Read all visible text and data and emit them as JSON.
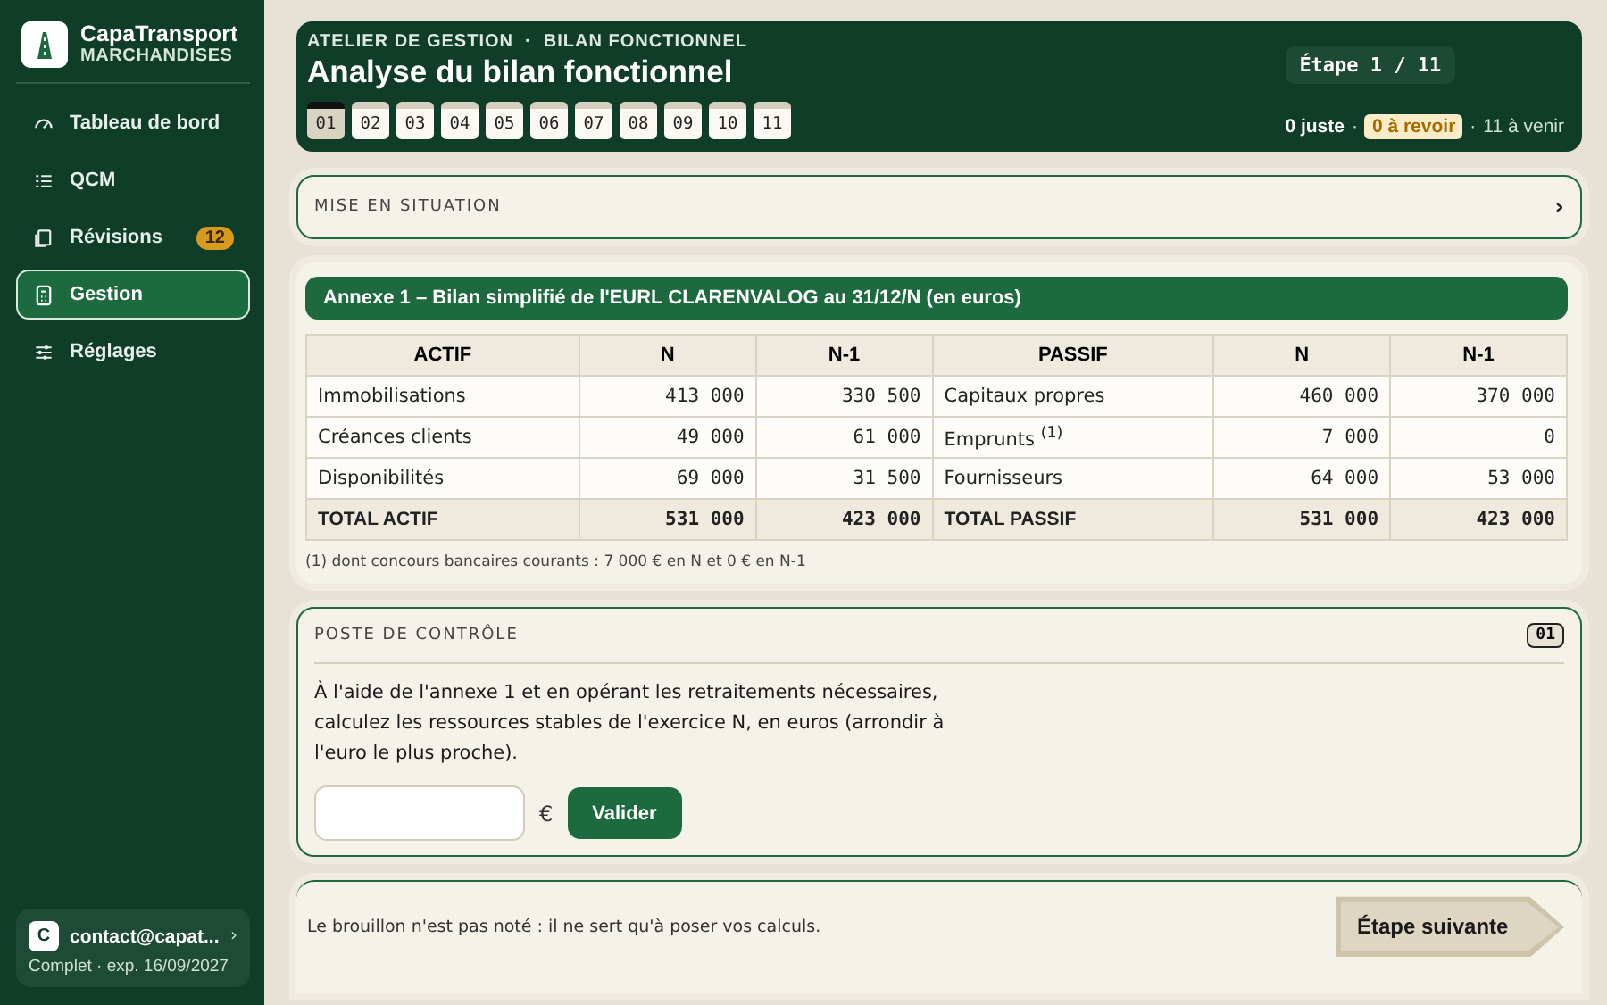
{
  "brand": {
    "name": "CapaTransport",
    "subtitle": "MARCHANDISES"
  },
  "nav": [
    {
      "label": "Tableau de bord",
      "selected": false
    },
    {
      "label": "QCM",
      "selected": false
    },
    {
      "label": "Révisions",
      "selected": false,
      "badge": "12"
    },
    {
      "label": "Gestion",
      "selected": true
    },
    {
      "label": "Réglages",
      "selected": false
    }
  ],
  "account": {
    "avatar": "C",
    "email": "contact@capat...",
    "chevron": "›",
    "plan": "Complet · exp. 16/09/2027"
  },
  "header": {
    "breadcrumb": "ATELIER DE GESTION  ·  BILAN FONCTIONNEL",
    "title": "Analyse du bilan fonctionnel",
    "step": "Étape 1 / 11",
    "steps": [
      {
        "label": "01",
        "selected": true
      },
      {
        "label": "02",
        "selected": false
      },
      {
        "label": "03",
        "selected": false
      },
      {
        "label": "04",
        "selected": false
      },
      {
        "label": "05",
        "selected": false
      },
      {
        "label": "06",
        "selected": false
      },
      {
        "label": "07",
        "selected": false
      },
      {
        "label": "08",
        "selected": false
      },
      {
        "label": "09",
        "selected": false
      },
      {
        "label": "10",
        "selected": false
      },
      {
        "label": "11",
        "selected": false
      }
    ],
    "score": [
      {
        "kind": "strong",
        "text": "0 juste"
      },
      {
        "kind": "sep",
        "text": "·"
      },
      {
        "kind": "badge",
        "text": "0 à revoir"
      },
      {
        "kind": "sep",
        "text": "·"
      },
      {
        "kind": "muted",
        "text": "11 à venir"
      }
    ]
  },
  "situation": {
    "title": "MISE EN SITUATION",
    "chevron": "›"
  },
  "annex": {
    "title": "Annexe 1 – Bilan simplifié de l'EURL CLARENVALOG au 31/12/N (en euros)",
    "columns": [
      "ACTIF",
      "N",
      "N-1",
      "PASSIF",
      "N",
      "N-1"
    ],
    "rows": [
      {
        "kind": "item",
        "cells": [
          "Immobilisations",
          "413 000",
          "330 500",
          "Capitaux propres",
          "460 000",
          "370 000"
        ]
      },
      {
        "kind": "item",
        "cells": [
          "Créances clients",
          "49 000",
          "61 000",
          "Emprunts $^{(1)}$",
          "7 000",
          "0"
        ]
      },
      {
        "kind": "item",
        "cells": [
          "Disponibilités",
          "69 000",
          "31 500",
          "Fournisseurs",
          "64 000",
          "53 000"
        ]
      },
      {
        "kind": "total",
        "cells": [
          "TOTAL ACTIF",
          "531 000",
          "423 000",
          "TOTAL PASSIF",
          "531 000",
          "423 000"
        ]
      }
    ],
    "footnote": "(1) dont concours bancaires courants : 7 000 € en N et 0 € en N-1"
  },
  "control": {
    "title": "POSTE DE CONTRÔLE",
    "number": "01",
    "question": "À l'aide de l'annexe 1 et en opérant les retraitements nécessaires, calculez les ressources stables de l'exercice N, en euros (arrondir à l'euro le plus proche).",
    "currency": "€",
    "submit": "Valider"
  },
  "footer": {
    "note": "Le brouillon n'est pas noté : il ne sert qu'à poser vos calculs.",
    "next": "Étape suivante"
  }
}
